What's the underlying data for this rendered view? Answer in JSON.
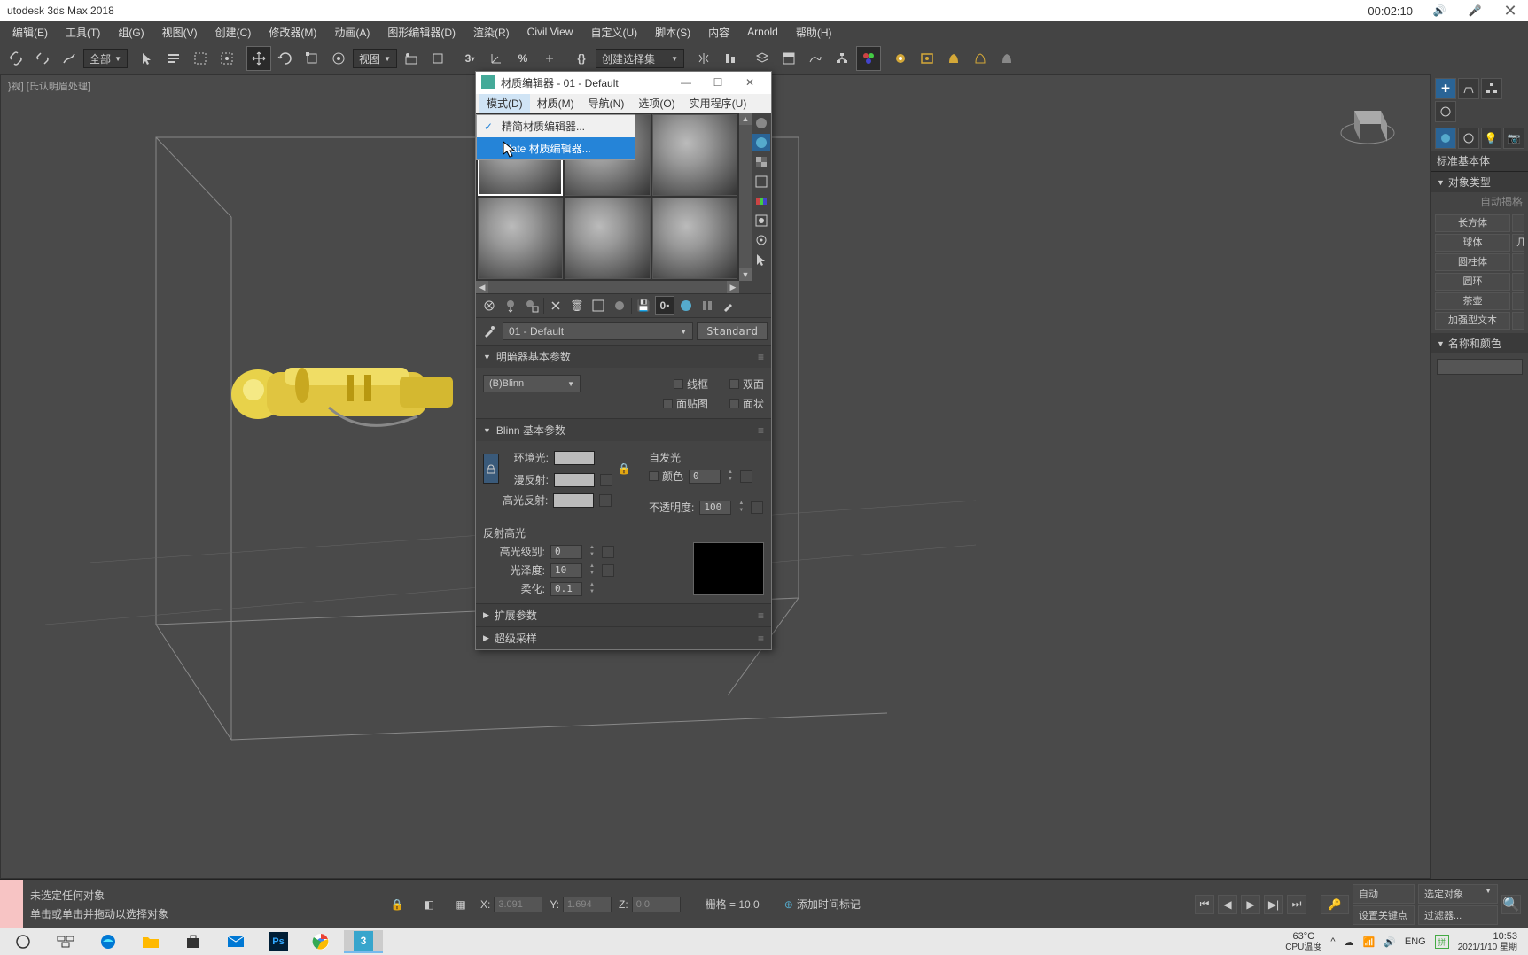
{
  "titlebar": {
    "appname": "utodesk 3ds Max 2018",
    "timer": "00:02:10"
  },
  "menubar": {
    "items": [
      "编辑(E)",
      "工具(T)",
      "组(G)",
      "视图(V)",
      "创建(C)",
      "修改器(M)",
      "动画(A)",
      "图形编辑器(D)",
      "渲染(R)",
      "Civil View",
      "自定义(U)",
      "脚本(S)",
      "内容",
      "Arnold",
      "帮助(H)"
    ]
  },
  "toolbar": {
    "dropdown1": "全部",
    "dropdown2": "视图",
    "dropdown3": "创建选择集"
  },
  "viewport": {
    "label": "}视] [氏认明眉处理]"
  },
  "command_panel": {
    "category": "标准基本体",
    "rollout1": "对象类型",
    "auto_grid": "自动揭格",
    "buttons": [
      [
        "长方体",
        ""
      ],
      [
        "球体",
        "几"
      ],
      [
        "圆柱体",
        ""
      ],
      [
        "圆环",
        ""
      ],
      [
        "茶壶",
        ""
      ],
      [
        "加强型文本",
        ""
      ]
    ],
    "rollout2": "名称和颜色"
  },
  "mat_editor": {
    "title": "材质编辑器 - 01 - Default",
    "menus": [
      "模式(D)",
      "材质(M)",
      "导航(N)",
      "选项(O)",
      "实用程序(U)"
    ],
    "dropdown_items": [
      "精简材质编辑器...",
      "Slate 材质编辑器..."
    ],
    "material_name": "01 - Default",
    "material_type": "Standard",
    "rollouts": {
      "shader": "明暗器基本参数",
      "blinn": "Blinn 基本参数",
      "extended": "扩展参数",
      "supersample": "超级采样"
    },
    "shader_name": "(B)Blinn",
    "options": {
      "wire": "线框",
      "two_sided": "双面",
      "face_map": "面贴图",
      "faceted": "面状"
    },
    "blinn": {
      "ambient": "环境光:",
      "diffuse": "漫反射:",
      "specular": "高光反射:",
      "self_illum": "自发光",
      "color": "颜色",
      "color_val": "0",
      "opacity": "不透明度:",
      "opacity_val": "100",
      "spec_highlights": "反射高光",
      "spec_level": "高光级别:",
      "spec_level_val": "0",
      "glossiness": "光泽度:",
      "glossiness_val": "10",
      "soften": "柔化:",
      "soften_val": "0.1"
    }
  },
  "status": {
    "line1": "未选定任何对象",
    "line2": "单击或单击并拖动以选择对象",
    "x": "3.091",
    "y": "1.694",
    "z": "0.0",
    "grid": "栅格 = 10.0",
    "add_time_tag": "添加时间标记",
    "auto": "自动",
    "set_key": "设置关键点",
    "selected": "选定对象",
    "filters": "过滤器..."
  },
  "taskbar": {
    "temp": "63°C",
    "cpu_temp": "CPU温度",
    "ime": "ENG",
    "time": "10:53",
    "date": "2021/1/10 星期"
  }
}
